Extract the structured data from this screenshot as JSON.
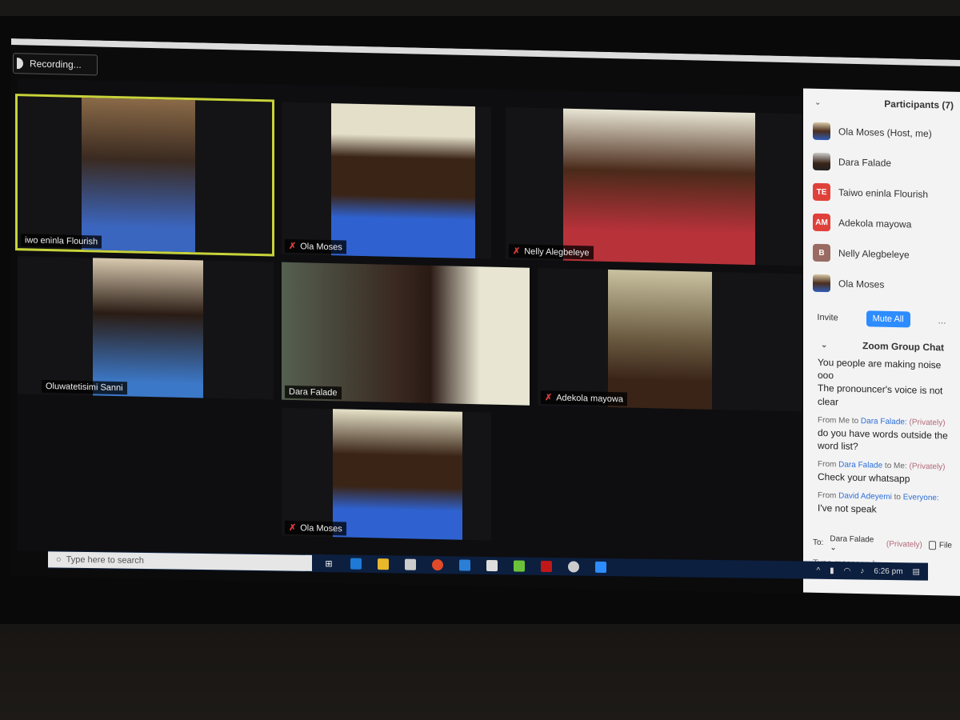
{
  "recording": {
    "label": "Recording..."
  },
  "tiles": [
    {
      "name": "Taiwo eninla Flourish",
      "display_name": "iwo eninla Flourish",
      "muted": false,
      "active": true
    },
    {
      "name": "Ola Moses",
      "display_name": "Ola Moses",
      "muted": true,
      "active": false
    },
    {
      "name": "Nelly Alegbeleye",
      "display_name": "Nelly Alegbeleye",
      "muted": true,
      "active": false
    },
    {
      "name": "Oluwatetisimi Sanni",
      "display_name": "Oluwatetisimi Sanni",
      "muted": false,
      "active": false
    },
    {
      "name": "Dara Falade",
      "display_name": "Dara Falade",
      "muted": false,
      "active": false
    },
    {
      "name": "Adekola mayowa",
      "display_name": "Adekola mayowa",
      "muted": true,
      "active": false
    },
    {
      "name": "Ola Moses",
      "display_name": "Ola Moses",
      "muted": true,
      "active": false
    }
  ],
  "participants": {
    "title": "Participants (7)",
    "items": [
      {
        "label": "Ola Moses (Host, me)",
        "avatar": "photo"
      },
      {
        "label": "Dara Falade",
        "avatar": "photo"
      },
      {
        "label": "Taiwo eninla Flourish",
        "avatar": "TE"
      },
      {
        "label": "Adekola mayowa",
        "avatar": "AM"
      },
      {
        "label": "Nelly Alegbeleye",
        "avatar": "B"
      },
      {
        "label": "Ola Moses",
        "avatar": "photo"
      }
    ],
    "invite_label": "Invite",
    "mute_all_label": "Mute All",
    "more_label": "..."
  },
  "chat": {
    "title": "Zoom Group Chat",
    "messages": [
      {
        "text": "You people are making noise ooo\nThe pronouncer's voice is not clear"
      },
      {
        "from": "Me",
        "to": "Dara Falade:",
        "privately": "(Privately)",
        "text": "do you have words outside the word list?"
      },
      {
        "from": "Dara Falade",
        "to": "Me:",
        "privately": "(Privately)",
        "text": "Check your whatsapp"
      },
      {
        "from": "David Adeyemi",
        "to": "Everyone:",
        "text": "I've not speak"
      }
    ],
    "to_label": "To:",
    "to_value": "Dara Falade",
    "privately": "(Privately)",
    "file_label": "File",
    "placeholder": "Type message here..."
  },
  "taskbar": {
    "search_placeholder": "Type here to search",
    "time": "6:26 pm"
  },
  "colors": {
    "active_speaker": "#c8d33a",
    "accent": "#2d8cff",
    "mute": "#e03a3a"
  }
}
